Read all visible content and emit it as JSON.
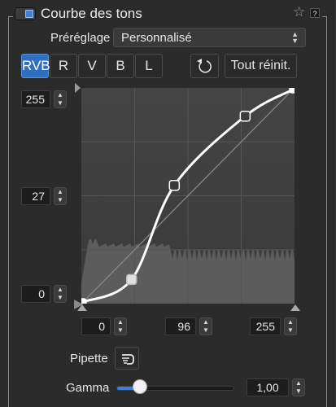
{
  "panel": {
    "title": "Courbe des tons",
    "star_icon": "☆",
    "help_label": "?"
  },
  "preset": {
    "label": "Préréglage",
    "value": "Personnalisé"
  },
  "channels": {
    "items": [
      "RVB",
      "R",
      "V",
      "B",
      "L"
    ],
    "active": "RVB"
  },
  "reset_button": "Tout réinit.",
  "output_levels": {
    "top": "255",
    "mid": "27",
    "bottom": "0"
  },
  "input_levels": {
    "black": "0",
    "mid": "96",
    "white": "255"
  },
  "curve": {
    "control_points": [
      [
        0,
        0
      ],
      [
        59,
        27
      ],
      [
        111,
        140
      ],
      [
        197,
        223
      ],
      [
        255,
        255
      ]
    ],
    "histogram_color": "#5c5c5c",
    "curve_color": "#ffffff"
  },
  "pipette": {
    "label": "Pipette",
    "icon": "pipette-icon"
  },
  "gamma": {
    "label": "Gamma",
    "value": "1,00",
    "level": 0.2
  },
  "colors": {
    "accent": "#2f6fbf",
    "panel_bg": "#2b2b2b"
  }
}
